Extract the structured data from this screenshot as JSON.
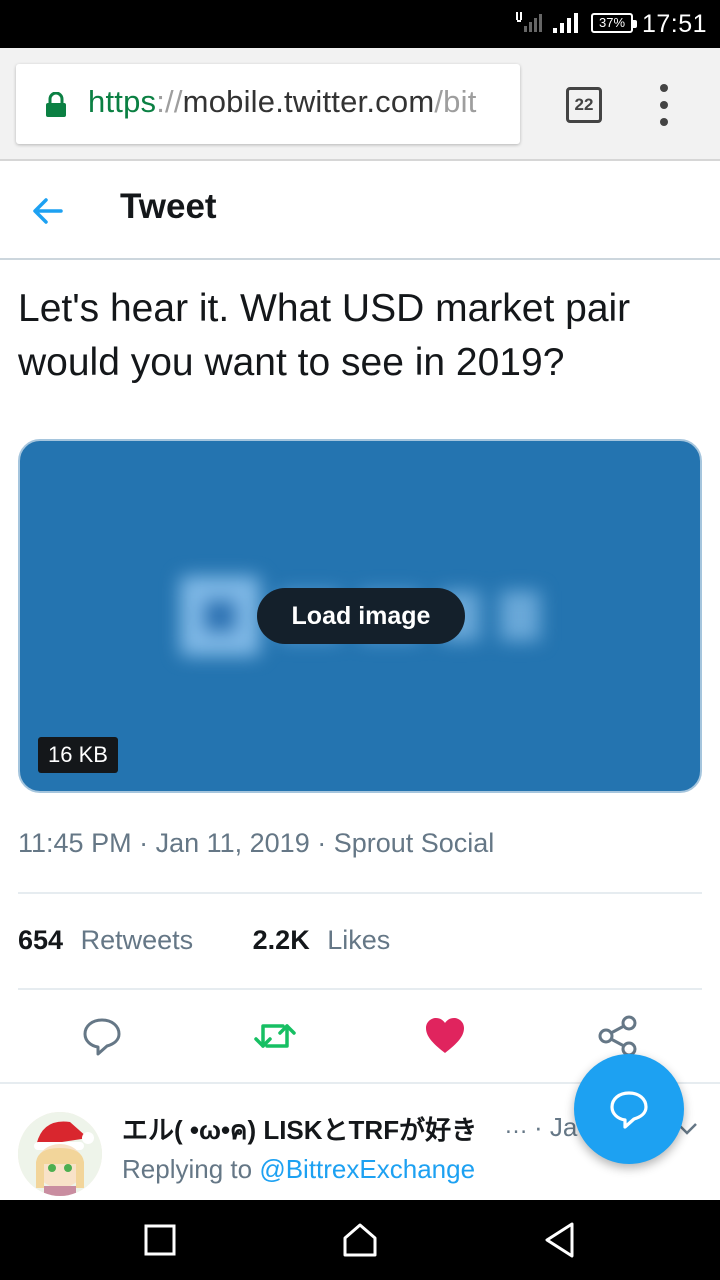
{
  "status_bar": {
    "battery": "37%",
    "time": "17:51"
  },
  "browser": {
    "url_scheme": "https",
    "url_sep": "://",
    "url_host": "mobile.twitter.com",
    "url_path": "/bit",
    "tab_count": "22"
  },
  "header": {
    "title": "Tweet"
  },
  "tweet": {
    "text": "Let's hear it. What USD market pair would you want to see in 2019?",
    "load_image_label": "Load image",
    "image_size": "16 KB",
    "time": "11:45 PM",
    "date": "Jan 11, 2019",
    "source": "Sprout Social",
    "retweets_count": "654",
    "retweets_label": "Retweets",
    "likes_count": "2.2K",
    "likes_label": "Likes"
  },
  "reply": {
    "author_name": "エル( •ω•ค) LISKとTRFが好き",
    "ellipsis": "…",
    "date_prefix": "· Ja",
    "replying_to_label": "Replying to",
    "replying_to_handle": "@BittrexExchange"
  },
  "colors": {
    "twitter_blue": "#1da1f2",
    "retweet_green": "#17bf63",
    "like_pink": "#e0245e",
    "media_bg": "#2474b0"
  }
}
